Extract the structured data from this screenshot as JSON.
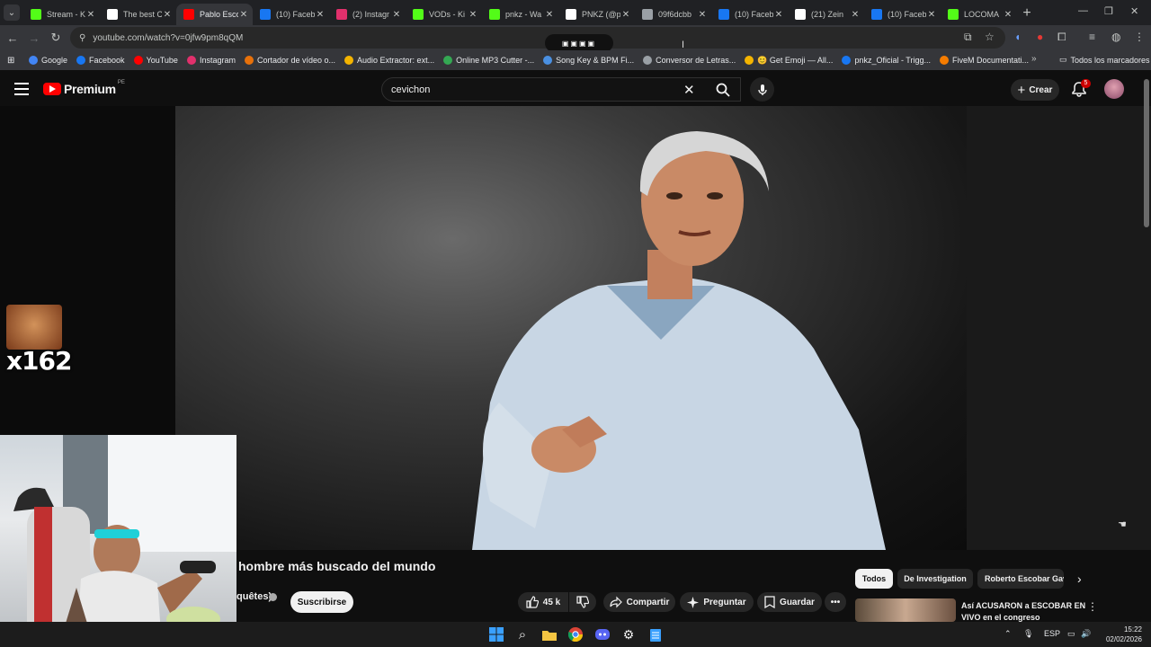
{
  "browser": {
    "tabs": [
      {
        "label": "Stream - K",
        "icon": "kick-icon",
        "color": "#53fc18"
      },
      {
        "label": "The best C",
        "icon": "github-icon",
        "color": "#ffffff"
      },
      {
        "label": "Pablo Esco",
        "icon": "youtube-icon",
        "color": "#ff0000",
        "active": true
      },
      {
        "label": "(10) Faceb",
        "icon": "facebook-icon",
        "color": "#1877f2"
      },
      {
        "label": "(2) Instagr",
        "icon": "instagram-icon",
        "color": "#e1306c"
      },
      {
        "label": "VODs - Ki",
        "icon": "kick-icon",
        "color": "#53fc18"
      },
      {
        "label": "pnkz - Wa",
        "icon": "kick-icon",
        "color": "#53fc18"
      },
      {
        "label": "PNKZ (@p",
        "icon": "tiktok-icon",
        "color": "#ffffff"
      },
      {
        "label": "09f6dcbb",
        "icon": "globe-icon",
        "color": "#9aa0a6"
      },
      {
        "label": "(10) Faceb",
        "icon": "facebook-icon",
        "color": "#1877f2"
      },
      {
        "label": "(21) Zein",
        "icon": "x-icon",
        "color": "#ffffff"
      },
      {
        "label": "(10) Faceb",
        "icon": "facebook-icon",
        "color": "#1877f2"
      },
      {
        "label": "LOCOMA",
        "icon": "kick-icon",
        "color": "#53fc18"
      }
    ],
    "url": "youtube.com/watch?v=0jfw9pm8qQM",
    "bookmarks": [
      {
        "label": "Google",
        "color": "#4285f4"
      },
      {
        "label": "Facebook",
        "color": "#1877f2"
      },
      {
        "label": "YouTube",
        "color": "#ff0000"
      },
      {
        "label": "Instagram",
        "color": "#e1306c"
      },
      {
        "label": "Cortador de vídeo o...",
        "color": "#e8710a"
      },
      {
        "label": "Audio Extractor: ext...",
        "color": "#f4b400"
      },
      {
        "label": "Online MP3 Cutter -...",
        "color": "#34a853"
      },
      {
        "label": "Song Key & BPM Fi...",
        "color": "#4a90e2"
      },
      {
        "label": "Conversor de Letras...",
        "color": "#9aa0a6"
      },
      {
        "label": "😊 Get Emoji — All...",
        "color": "#f4b400"
      },
      {
        "label": "pnkz_Oficial - Trigg...",
        "color": "#1877f2"
      },
      {
        "label": "FiveM Documentati...",
        "color": "#f57c00"
      }
    ],
    "all_bookmarks": "Todos los marcadores"
  },
  "youtube": {
    "logo_text": "Premium",
    "region": "PE",
    "search_query": "cevichon",
    "create_label": "Crear",
    "notifications": "5",
    "video_title": "hombre más buscado del mundo",
    "channel": "quêtes)",
    "subscribe_label": "Suscribirse",
    "likes": "45 k",
    "share_label": "Compartir",
    "ask_label": "Preguntar",
    "save_label": "Guardar",
    "chips": [
      "Todos",
      "De Investigation",
      "Roberto Escobar Gav"
    ],
    "recommendation_title": "Así ACUSARON a ESCOBAR EN VIVO en el congreso"
  },
  "stream": {
    "emote_count": "x162"
  },
  "taskbar": {
    "language": "ESP",
    "time": "15:22",
    "date": "02/02/2026"
  }
}
